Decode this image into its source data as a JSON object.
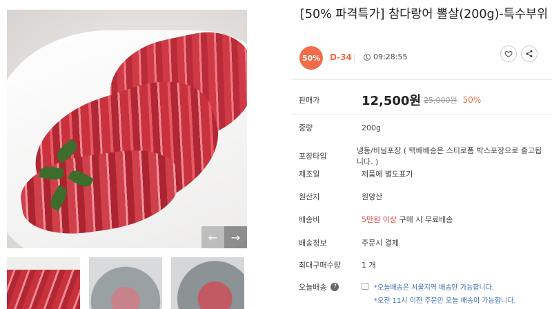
{
  "gallery": {
    "prev_arrow": "←",
    "next_arrow": "→"
  },
  "product": {
    "title": "[50% 파격특가] 참다랑어 뽈살(200g)-특수부위",
    "discount_badge": "50%",
    "dday": "D-34",
    "timer": "09:28:55",
    "like_icon": "heart-icon",
    "share_icon": "share-icon"
  },
  "info": {
    "price_label": "판매가",
    "price": "12,500원",
    "original_price": "25,000원",
    "discount_rate": "50%",
    "weight_label": "중량",
    "weight": "200g",
    "packaging_label": "포장타입",
    "packaging": "냉동/비닐포장 ( 택배배송은 스티로폼 박스포장으로 출고됩니다. )",
    "manufacture_label": "제조일",
    "manufacture": "제품에 별도표기",
    "origin_label": "원산지",
    "origin": "원양산",
    "shipping_fee_label": "배송비",
    "shipping_fee_highlight": "5만원 이상",
    "shipping_fee_rest": " 구매 시 무료배송",
    "shipping_info_label": "배송정보",
    "shipping_info": "주문시 결제",
    "max_qty_label": "최대구매수량",
    "max_qty": "1 개",
    "today_delivery_label": "오늘배송",
    "today_delivery_help": "?",
    "today_delivery_note1": "*오늘배송은 서울지역 배송만 가능합니다.",
    "today_delivery_note2": "*오전 11시 이전 주문만 오늘 배송이 가능합니다."
  },
  "colors": {
    "accent": "#f26b4a",
    "highlight_red": "#e04040",
    "note_blue": "#3c6fb0"
  }
}
